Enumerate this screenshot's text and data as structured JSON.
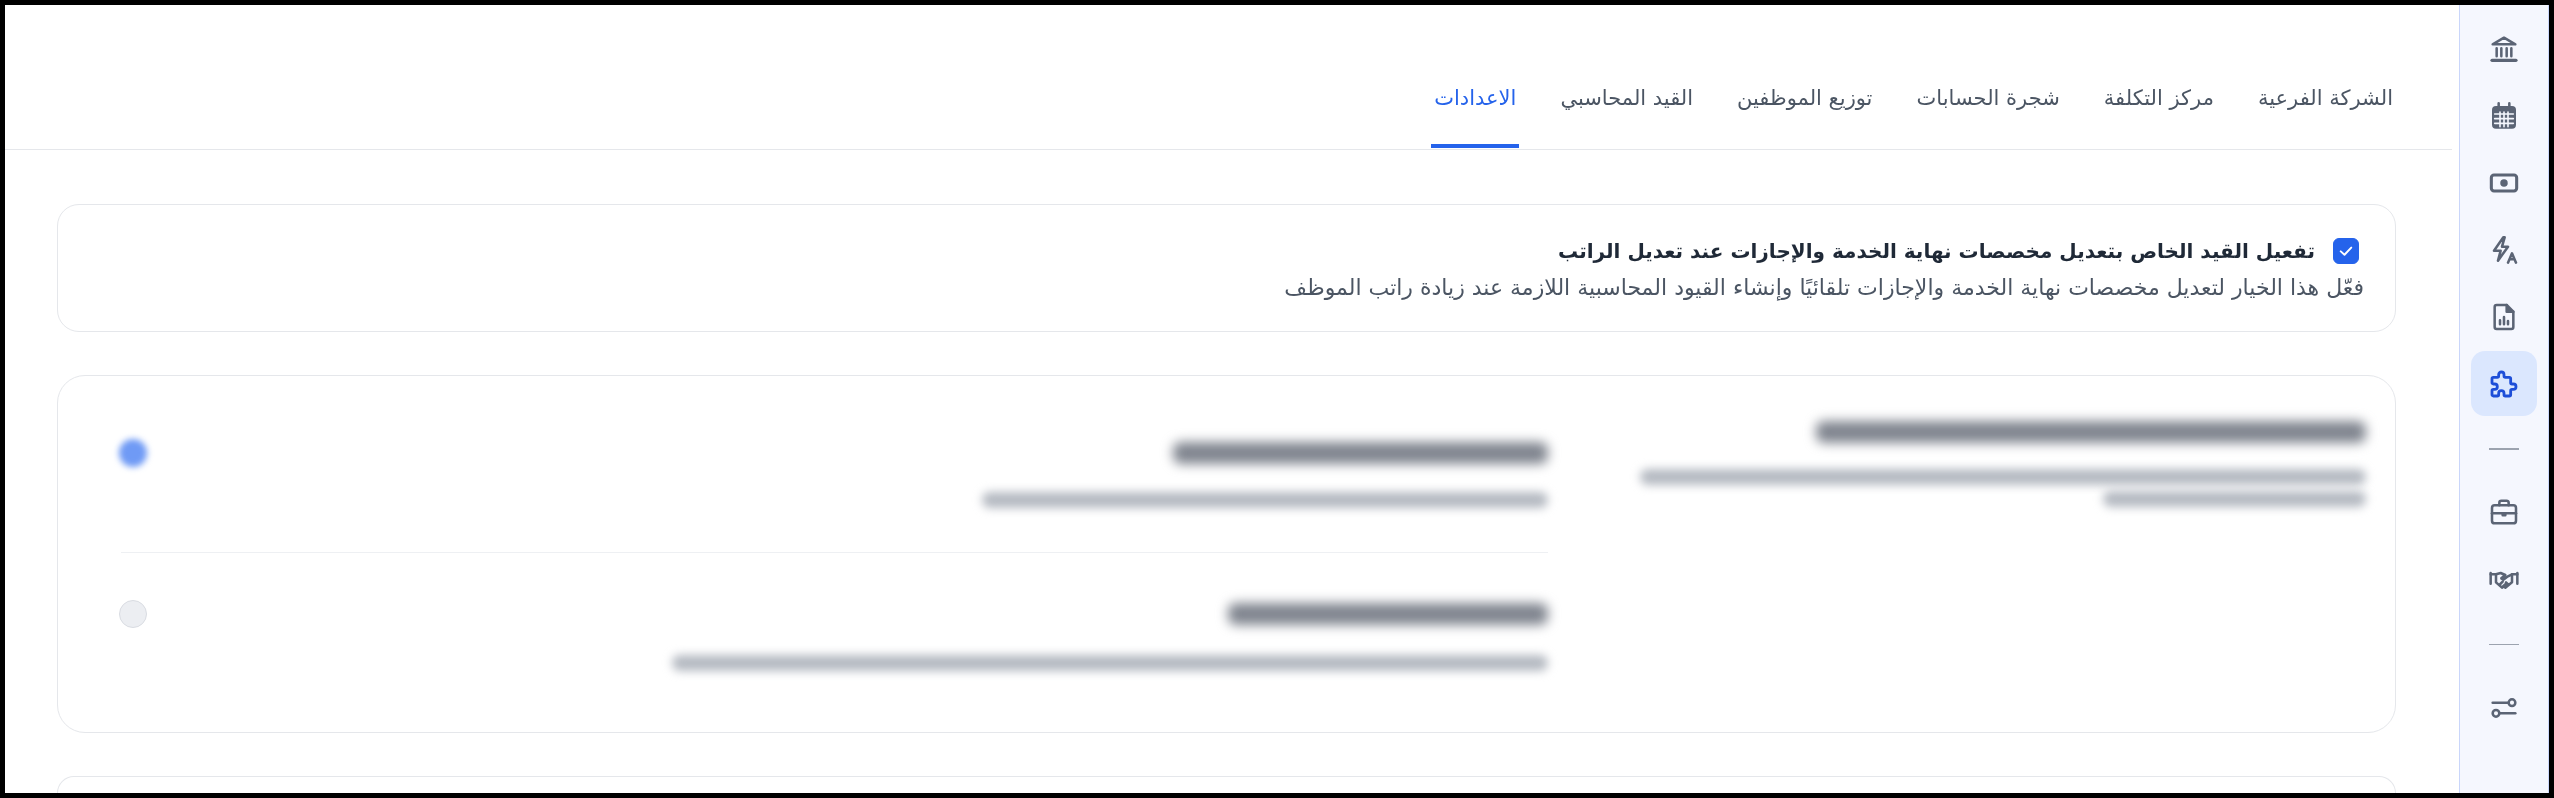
{
  "tabs": [
    {
      "label": "الشركة الفرعية",
      "selected": false
    },
    {
      "label": "مركز التكلفة",
      "selected": false
    },
    {
      "label": "شجرة الحسابات",
      "selected": false
    },
    {
      "label": "توزيع الموظفين",
      "selected": false
    },
    {
      "label": "القيد المحاسبي",
      "selected": false
    },
    {
      "label": "الاعدادات",
      "selected": true
    }
  ],
  "setting": {
    "checked": true,
    "title": "تفعيل القيد الخاص بتعديل مخصصات نهاية الخدمة والإجازات عند تعديل الراتب",
    "description": "فعّل هذا الخيار لتعديل مخصصات نهاية الخدمة والإجازات تلقائيًا وإنشاء القيود المحاسبية اللازمة عند زيادة راتب الموظف"
  },
  "sidebar": {
    "groups": [
      {
        "items": [
          {
            "selected": false
          },
          {
            "selected": false
          },
          {
            "selected": false
          },
          {
            "selected": false
          },
          {
            "selected": false
          },
          {
            "selected": true
          }
        ]
      },
      {
        "items": [
          {
            "selected": false
          },
          {
            "selected": false
          }
        ]
      },
      {
        "items": [
          {
            "selected": false
          }
        ]
      }
    ]
  }
}
